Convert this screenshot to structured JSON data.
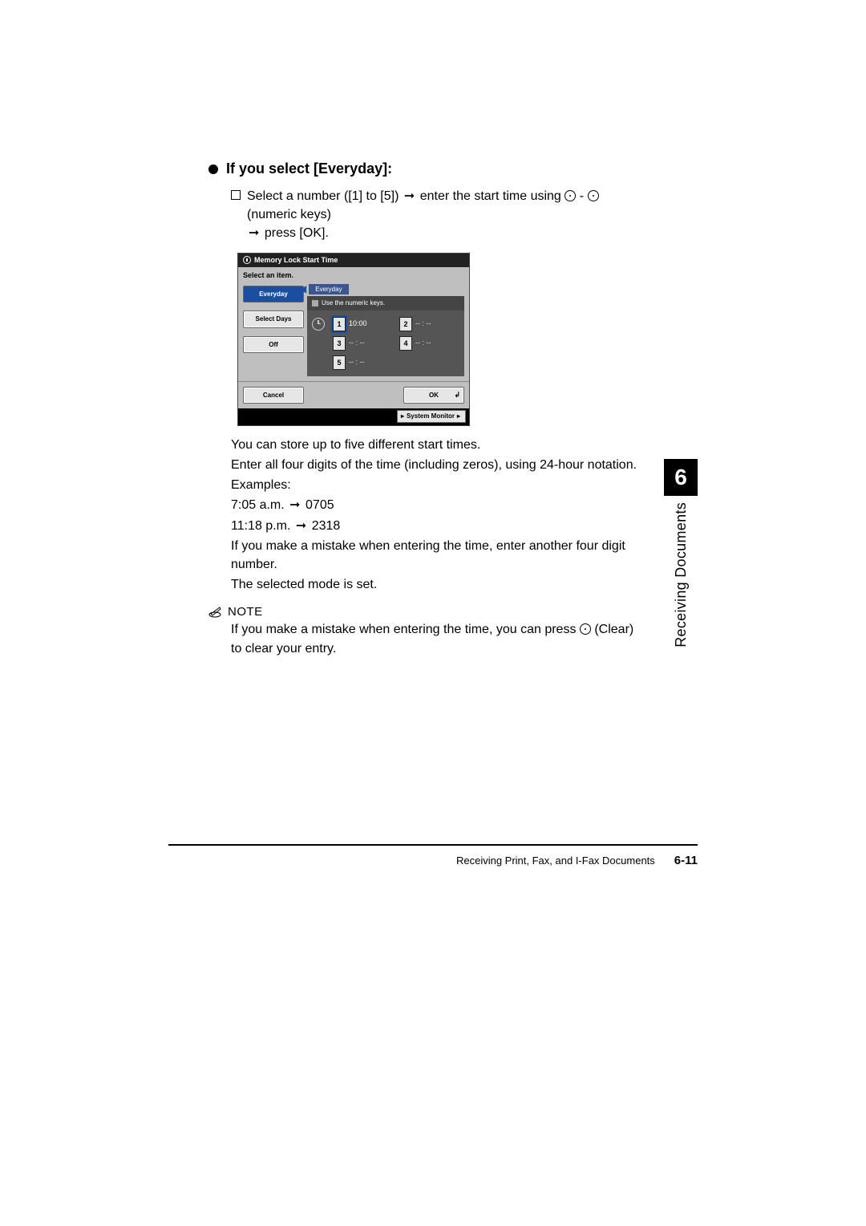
{
  "heading": "If you select [Everyday]:",
  "step": {
    "pre": "Select a number ([1] to [5]) ",
    "mid": " enter the start time using ",
    "keys_sep": " - ",
    "keys_label": " (numeric keys) ",
    "end": " press [OK]."
  },
  "ui": {
    "title": "Memory Lock Start Time",
    "subtitle": "Select an item.",
    "left": {
      "everyday": "Everyday",
      "select_days": "Select Days",
      "off": "Off"
    },
    "mode_tab": "Everyday",
    "instruction": "Use the numeric keys.",
    "slots": {
      "s1": {
        "num": "1",
        "time": "0:00",
        "prefix": "1"
      },
      "s2": {
        "num": "2",
        "time": "-- : --"
      },
      "s3": {
        "num": "3",
        "time": "-- : --"
      },
      "s4": {
        "num": "4",
        "time": "-- : --"
      },
      "s5": {
        "num": "5",
        "time": "-- : --"
      }
    },
    "cancel": "Cancel",
    "ok": "OK",
    "system_monitor": "System Monitor"
  },
  "body": {
    "l1": "You can store up to five different start times.",
    "l2": "Enter all four digits of the time (including zeros), using 24-hour notation.",
    "l3": "Examples:",
    "ex1_a": "7:05 a.m. ",
    "ex1_b": " 0705",
    "ex2_a": "11:18 p.m. ",
    "ex2_b": " 2318",
    "l4": "If you make a mistake when entering the time, enter another four digit number.",
    "l5": "The selected mode is set."
  },
  "note": {
    "label": "NOTE",
    "text_a": "If you make a mistake when entering the time, you can press ",
    "text_b": " (Clear) to clear your entry."
  },
  "side": {
    "num": "6",
    "label": "Receiving Documents"
  },
  "footer": {
    "section": "Receiving Print, Fax, and I-Fax Documents",
    "page": "6-11"
  }
}
